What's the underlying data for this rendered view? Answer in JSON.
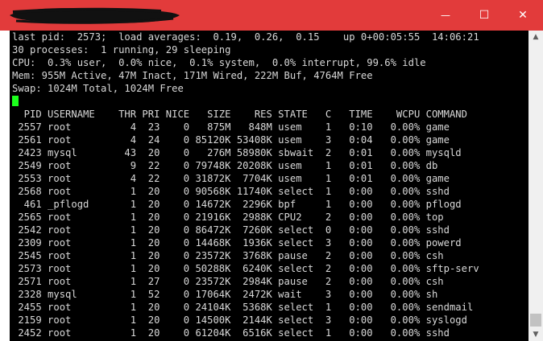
{
  "window": {
    "minimize_glyph": "—",
    "maximize_glyph": "☐",
    "close_glyph": "✕",
    "scroll_up_glyph": "▲",
    "scroll_down_glyph": "▼",
    "titlebar_color": "#e23b3b"
  },
  "terminal": {
    "summary": {
      "line1": "last pid:  2573;  load averages:  0.19,  0.26,  0.15    up 0+00:05:55  14:06:21",
      "line2": "30 processes:  1 running, 29 sleeping",
      "line3": "CPU:  0.3% user,  0.0% nice,  0.1% system,  0.0% interrupt, 99.6% idle",
      "line4": "Mem: 955M Active, 47M Inact, 171M Wired, 222M Buf, 4764M Free",
      "line5": "Swap: 1024M Total, 1024M Free"
    },
    "header": "  PID USERNAME    THR PRI NICE   SIZE    RES STATE   C   TIME    WCPU COMMAND",
    "rows": [
      " 2557 root          4  23    0   875M   848M usem    1   0:10   0.00% game",
      " 2561 root          4  24    0 85120K 53408K usem    3   0:04   0.00% game",
      " 2423 mysql        43  20    0   276M 58980K sbwait  2   0:01   0.00% mysqld",
      " 2549 root          9  22    0 79748K 20208K usem    1   0:01   0.00% db",
      " 2553 root          4  22    0 31872K  7704K usem    1   0:01   0.00% game",
      " 2568 root          1  20    0 90568K 11740K select  1   0:00   0.00% sshd",
      "  461 _pflogd       1  20    0 14672K  2296K bpf     1   0:00   0.00% pflogd",
      " 2565 root          1  20    0 21916K  2988K CPU2    2   0:00   0.00% top",
      " 2542 root          1  20    0 86472K  7260K select  0   0:00   0.00% sshd",
      " 2309 root          1  20    0 14468K  1936K select  3   0:00   0.00% powerd",
      " 2545 root          1  20    0 23572K  3768K pause   2   0:00   0.00% csh",
      " 2573 root          1  20    0 50288K  6240K select  2   0:00   0.00% sftp-serv",
      " 2571 root          1  27    0 23572K  2984K pause   2   0:00   0.00% csh",
      " 2328 mysql         1  52    0 17064K  2472K wait    3   0:00   0.00% sh",
      " 2455 root          1  20    0 24104K  5368K select  1   0:00   0.00% sendmail",
      " 2159 root          1  20    0 14500K  2144K select  3   0:00   0.00% syslogd",
      " 2452 root          1  20    0 61204K  6516K select  1   0:00   0.00% sshd"
    ],
    "text_color": "#d8d8d8",
    "background_color": "#000000",
    "cursor_color": "#1cff1c"
  }
}
